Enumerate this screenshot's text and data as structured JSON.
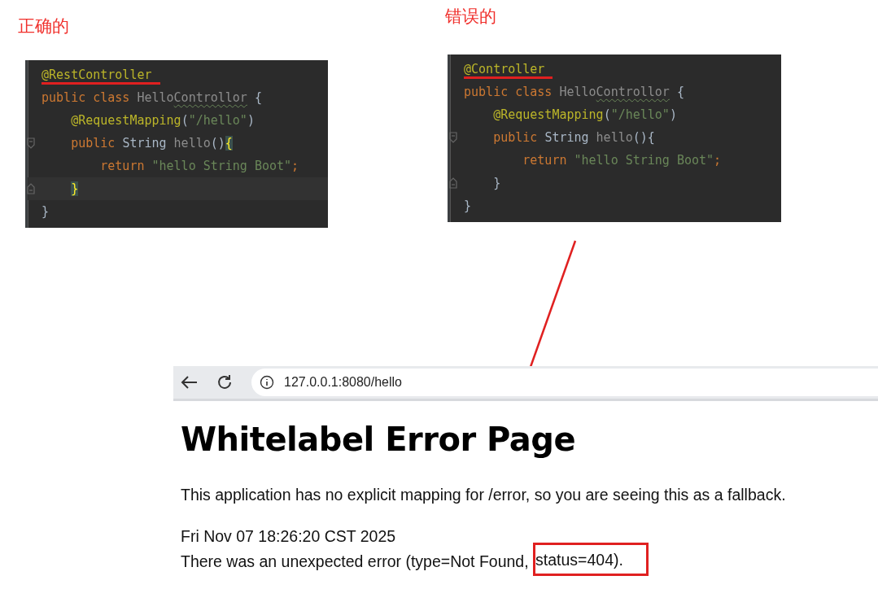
{
  "code_panels": [
    {
      "caption": "正确的",
      "lines": [
        {
          "current": false,
          "fold_marker": false,
          "tokens": [
            {
              "kind": "annotation",
              "text": "@RestController",
              "marked": true
            }
          ]
        },
        {
          "current": false,
          "fold_marker": false,
          "tokens": [
            {
              "kind": "keyword",
              "text": "public class "
            },
            {
              "kind": "unused",
              "text": "Hello"
            },
            {
              "kind": "unused-warning",
              "text": "Controllor"
            },
            {
              "kind": "plain",
              "text": " {"
            }
          ]
        },
        {
          "current": false,
          "fold_marker": false,
          "tokens": [
            {
              "kind": "annotation",
              "text": "    @RequestMapping"
            },
            {
              "kind": "plain",
              "text": "("
            },
            {
              "kind": "string",
              "text": "\"/hello\""
            },
            {
              "kind": "plain",
              "text": ")"
            }
          ]
        },
        {
          "current": false,
          "fold_marker": true,
          "tokens": [
            {
              "kind": "keyword",
              "text": "    public "
            },
            {
              "kind": "plain",
              "text": "String "
            },
            {
              "kind": "unused",
              "text": "hello"
            },
            {
              "kind": "plain",
              "text": "()"
            },
            {
              "kind": "matched-brace",
              "text": "{"
            }
          ]
        },
        {
          "current": false,
          "fold_marker": false,
          "tokens": [
            {
              "kind": "keyword",
              "text": "        return "
            },
            {
              "kind": "string",
              "text": "\"hello String Boot\""
            },
            {
              "kind": "keyword",
              "text": ";"
            }
          ]
        },
        {
          "current": true,
          "fold_marker": true,
          "tokens": [
            {
              "kind": "matched-brace",
              "text": "    }"
            }
          ]
        },
        {
          "current": false,
          "fold_marker": false,
          "tokens": [
            {
              "kind": "plain",
              "text": "}"
            }
          ]
        }
      ]
    },
    {
      "caption": "错误的",
      "lines": [
        {
          "current": false,
          "fold_marker": false,
          "tokens": [
            {
              "kind": "annotation",
              "text": "@Controller",
              "marked": true
            }
          ]
        },
        {
          "current": false,
          "fold_marker": false,
          "tokens": [
            {
              "kind": "keyword",
              "text": "public class "
            },
            {
              "kind": "unused",
              "text": "Hello"
            },
            {
              "kind": "unused-warning",
              "text": "Controllor"
            },
            {
              "kind": "plain",
              "text": " {"
            }
          ]
        },
        {
          "current": false,
          "fold_marker": false,
          "tokens": [
            {
              "kind": "annotation",
              "text": "    @RequestMapping"
            },
            {
              "kind": "plain",
              "text": "("
            },
            {
              "kind": "string",
              "text": "\"/hello\""
            },
            {
              "kind": "plain",
              "text": ")"
            }
          ]
        },
        {
          "current": false,
          "fold_marker": true,
          "tokens": [
            {
              "kind": "keyword",
              "text": "    public "
            },
            {
              "kind": "plain",
              "text": "String "
            },
            {
              "kind": "unused",
              "text": "hello"
            },
            {
              "kind": "plain",
              "text": "(){"
            }
          ]
        },
        {
          "current": false,
          "fold_marker": false,
          "tokens": [
            {
              "kind": "keyword",
              "text": "        return "
            },
            {
              "kind": "string",
              "text": "\"hello String Boot\""
            },
            {
              "kind": "keyword",
              "text": ";"
            }
          ]
        },
        {
          "current": false,
          "fold_marker": true,
          "tokens": [
            {
              "kind": "plain",
              "text": "    }"
            }
          ]
        },
        {
          "current": false,
          "fold_marker": false,
          "tokens": [
            {
              "kind": "plain",
              "text": "}"
            }
          ]
        }
      ]
    }
  ],
  "browser": {
    "url": "127.0.0.1:8080/hello",
    "heading": "Whitelabel Error Page",
    "paragraphs": [
      {
        "segments": [
          {
            "text": "This application has no explicit mapping for /error, so you are seeing this as a fallback.",
            "boxed": false
          }
        ]
      },
      {
        "segments": [
          {
            "text": "Fri Nov 07 18:26:20 CST 2025",
            "boxed": false
          }
        ]
      },
      {
        "segments": [
          {
            "text": "There was an unexpected error (type=Not Found, ",
            "boxed": false
          },
          {
            "text": "status=404).",
            "boxed": true
          }
        ]
      }
    ]
  }
}
